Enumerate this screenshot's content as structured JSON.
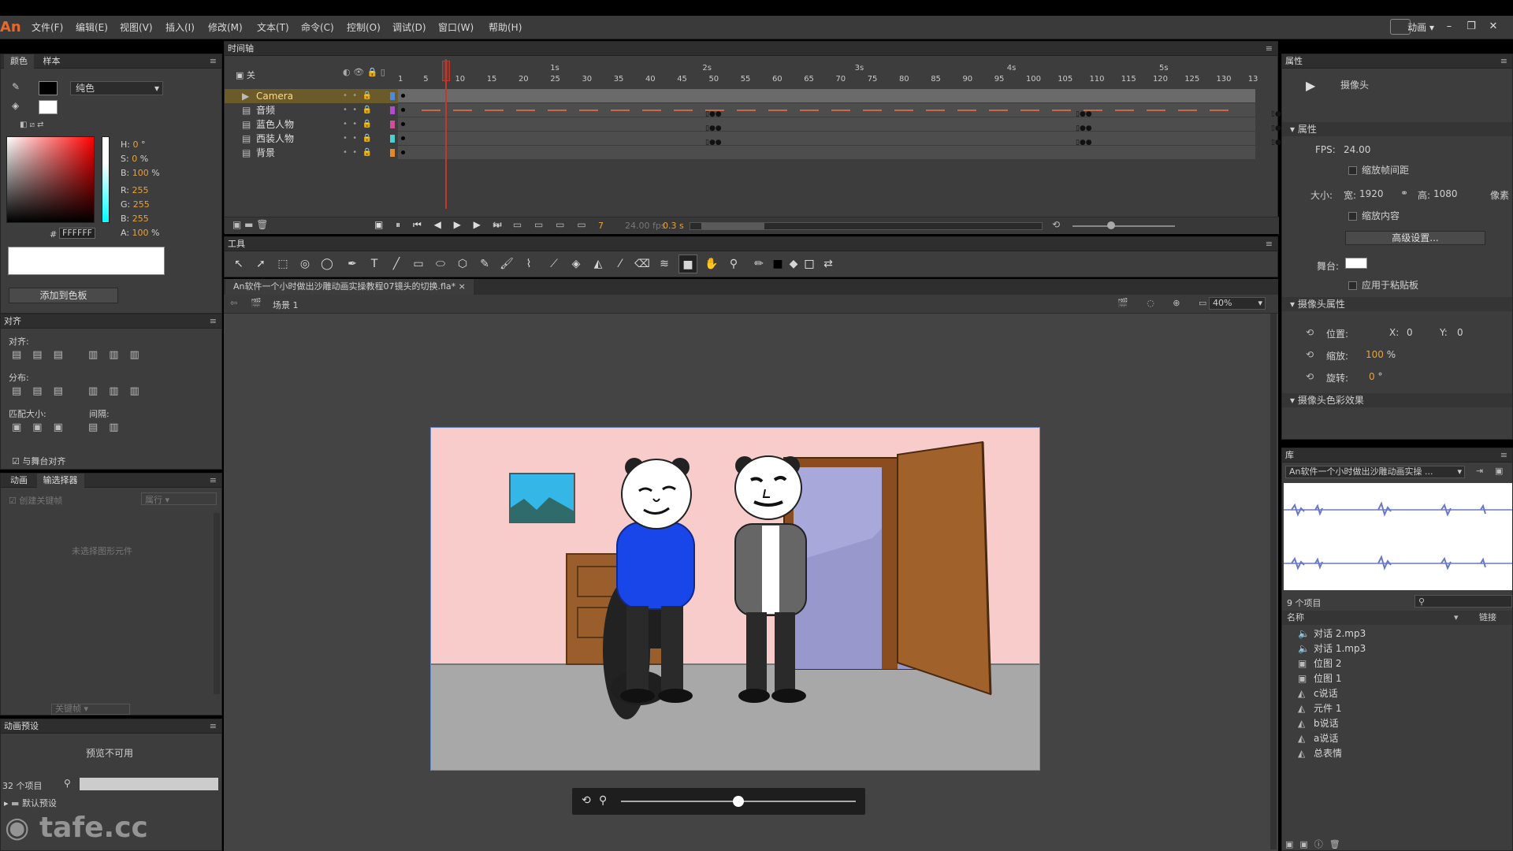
{
  "app": {
    "logo": "An"
  },
  "menu": [
    "文件(F)",
    "编辑(E)",
    "视图(V)",
    "插入(I)",
    "修改(M)",
    "文本(T)",
    "命令(C)",
    "控制(O)",
    "调试(D)",
    "窗口(W)",
    "帮助(H)"
  ],
  "workspace": "动画",
  "color_panel": {
    "tabs": [
      "颜色",
      "样本"
    ],
    "fill_type": "纯色",
    "hsb": {
      "h_label": "H:",
      "h": "0",
      "h_unit": "°",
      "s_label": "S:",
      "s": "0",
      "s_unit": "%",
      "b_label": "B:",
      "b": "100",
      "b_unit": "%"
    },
    "rgb": {
      "r_label": "R:",
      "r": "255",
      "g_label": "G:",
      "g": "255",
      "b_label": "B:",
      "b": "255",
      "a_label": "A:",
      "a": "100",
      "a_unit": "%"
    },
    "hex_prefix": "#",
    "hex": "FFFFFF",
    "add_button": "添加到色板"
  },
  "align_panel": {
    "title": "对齐",
    "align_label": "对齐:",
    "distribute_label": "分布:",
    "match_size_label": "匹配大小:",
    "spacing_label": "间隔:",
    "stage_align": "与舞台对齐"
  },
  "motion_panel": {
    "tabs": [
      "动画",
      "输选择器"
    ],
    "create_label": "创建关键帧",
    "dropdown": "属行",
    "empty_text": "未选择图形元件",
    "keyframe_label": "关键帧"
  },
  "presets_panel": {
    "title": "动画预设",
    "preview": "预览不可用",
    "count": "32 个项目",
    "folder": "默认预设"
  },
  "watermark": "tafe.cc",
  "timeline": {
    "title": "时间轴",
    "header_label": "关",
    "layers": [
      {
        "name": "Camera",
        "type": "camera"
      },
      {
        "name": "音频",
        "type": "audio"
      },
      {
        "name": "蓝色人物",
        "type": "layer"
      },
      {
        "name": "西装人物",
        "type": "layer"
      },
      {
        "name": "背景",
        "type": "layer"
      }
    ],
    "frame_numbers": [
      "1",
      "5",
      "10",
      "15",
      "20",
      "25",
      "30",
      "35",
      "40",
      "45",
      "50",
      "55",
      "60",
      "65",
      "70",
      "75",
      "80",
      "85",
      "90",
      "95",
      "100",
      "105",
      "110",
      "115",
      "120",
      "125",
      "130",
      "13"
    ],
    "seconds": [
      "1s",
      "2s",
      "3s",
      "4s",
      "5s"
    ],
    "current_frame": "7",
    "fps_display": "24.00 fps",
    "time_display": "0.3 s"
  },
  "tools_panel": {
    "title": "工具"
  },
  "document": {
    "tab_title": "An软件一个小时做出沙雕动画实操教程07镜头的切换.fla*",
    "tab_close": "×",
    "scene": "场景 1",
    "zoom": "40%"
  },
  "properties": {
    "title": "属性",
    "object": "摄像头",
    "section_props": "属性",
    "fps_label": "FPS:",
    "fps": "24.00",
    "scale_span": "缩放帧间距",
    "size_label": "大小:",
    "width_label": "宽:",
    "width": "1920",
    "height_label": "高:",
    "height": "1080",
    "unit": "像素",
    "scale_content": "缩放内容",
    "advanced_btn": "高级设置...",
    "stage_label": "舞台:",
    "apply_pasteboard": "应用于粘贴板",
    "camera_section": "摄像头属性",
    "pos_label": "位置:",
    "x_label": "X:",
    "x": "0",
    "y_label": "Y:",
    "y": "0",
    "zoom_label": "缩放:",
    "zoom": "100",
    "zoom_unit": "%",
    "rotate_label": "旋转:",
    "rotate": "0",
    "rotate_unit": "°",
    "color_section": "摄像头色彩效果"
  },
  "library": {
    "title": "库",
    "doc": "An软件一个小时做出沙雕动画实操 ...",
    "count": "9 个项目",
    "col_name": "名称",
    "col_link": "链接",
    "items": [
      {
        "name": "对话 2.mp3",
        "icon": "sound-icon"
      },
      {
        "name": "对话 1.mp3",
        "icon": "sound-icon"
      },
      {
        "name": "位图 2",
        "icon": "bitmap-icon"
      },
      {
        "name": "位图 1",
        "icon": "bitmap-icon"
      },
      {
        "name": "c说话",
        "icon": "symbol-icon"
      },
      {
        "name": "元件 1",
        "icon": "symbol-icon"
      },
      {
        "name": "b说话",
        "icon": "symbol-icon"
      },
      {
        "name": "a说话",
        "icon": "symbol-icon"
      },
      {
        "name": "总表情",
        "icon": "symbol-icon"
      }
    ]
  },
  "camera_slider": {
    "value": 0.5
  },
  "colors": {
    "accent": "#e8a23a",
    "playhead": "#c0392b",
    "stage_wall": "#f9cccc",
    "stage_floor": "#a8a8a8"
  }
}
